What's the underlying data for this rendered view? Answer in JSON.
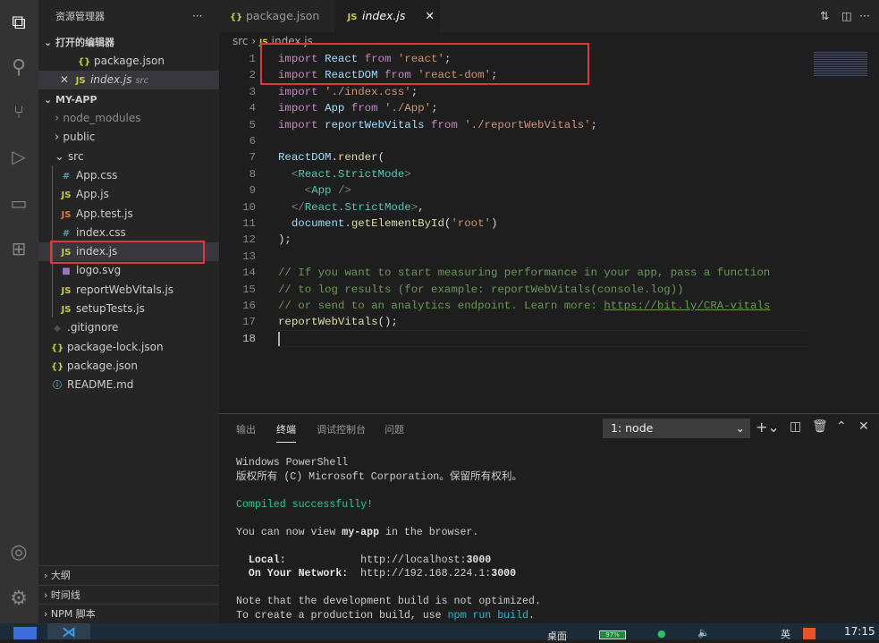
{
  "sidebar": {
    "title": "资源管理器",
    "more": "···",
    "open_editors": "打开的编辑器",
    "open_items": [
      {
        "icon": "{}",
        "name": "package.json",
        "dir": ""
      },
      {
        "icon": "JS",
        "name": "index.js",
        "dir": "src"
      }
    ],
    "project": "MY-APP",
    "tree": [
      {
        "label": "node_modules",
        "type": "folder",
        "depth": 0,
        "expanded": false,
        "dim": true
      },
      {
        "label": "public",
        "type": "folder",
        "depth": 0,
        "expanded": false
      },
      {
        "label": "src",
        "type": "folder",
        "depth": 0,
        "expanded": true
      },
      {
        "label": "App.css",
        "icon": "#",
        "cls": "css",
        "depth": 1
      },
      {
        "label": "App.js",
        "icon": "JS",
        "cls": "js",
        "depth": 1
      },
      {
        "label": "App.test.js",
        "icon": "JS",
        "cls": "jsr",
        "depth": 1
      },
      {
        "label": "index.css",
        "icon": "#",
        "cls": "css",
        "depth": 1
      },
      {
        "label": "index.js",
        "icon": "JS",
        "cls": "js",
        "depth": 1,
        "selected": true
      },
      {
        "label": "logo.svg",
        "icon": "■",
        "cls": "svg",
        "depth": 1
      },
      {
        "label": "reportWebVitals.js",
        "icon": "JS",
        "cls": "js",
        "depth": 1
      },
      {
        "label": "setupTests.js",
        "icon": "JS",
        "cls": "js",
        "depth": 1
      },
      {
        "label": ".gitignore",
        "icon": "◆",
        "cls": "git",
        "depth": 0
      },
      {
        "label": "package-lock.json",
        "icon": "{}",
        "cls": "json",
        "depth": 0
      },
      {
        "label": "package.json",
        "icon": "{}",
        "cls": "json",
        "depth": 0
      },
      {
        "label": "README.md",
        "icon": "ⓘ",
        "cls": "css",
        "depth": 0
      }
    ],
    "bottom": [
      "大纲",
      "时间线",
      "NPM 脚本"
    ]
  },
  "tabs": [
    {
      "icon": "{}",
      "label": "package.json",
      "active": false
    },
    {
      "icon": "JS",
      "label": "index.js",
      "active": true
    }
  ],
  "breadcrumb": {
    "folder": "src",
    "file": "index.js"
  },
  "code": [
    [
      [
        "k",
        "import"
      ],
      [
        "d",
        " "
      ],
      [
        "v",
        "React"
      ],
      [
        "d",
        " "
      ],
      [
        "k",
        "from"
      ],
      [
        "d",
        " "
      ],
      [
        "s",
        "'react'"
      ],
      [
        "d",
        ";"
      ]
    ],
    [
      [
        "k",
        "import"
      ],
      [
        "d",
        " "
      ],
      [
        "v",
        "ReactDOM"
      ],
      [
        "d",
        " "
      ],
      [
        "k",
        "from"
      ],
      [
        "d",
        " "
      ],
      [
        "s",
        "'react-dom'"
      ],
      [
        "d",
        ";"
      ]
    ],
    [
      [
        "k",
        "import"
      ],
      [
        "d",
        " "
      ],
      [
        "s",
        "'./index.css'"
      ],
      [
        "d",
        ";"
      ]
    ],
    [
      [
        "k",
        "import"
      ],
      [
        "d",
        " "
      ],
      [
        "v",
        "App"
      ],
      [
        "d",
        " "
      ],
      [
        "k",
        "from"
      ],
      [
        "d",
        " "
      ],
      [
        "s",
        "'./App'"
      ],
      [
        "d",
        ";"
      ]
    ],
    [
      [
        "k",
        "import"
      ],
      [
        "d",
        " "
      ],
      [
        "v",
        "reportWebVitals"
      ],
      [
        "d",
        " "
      ],
      [
        "k",
        "from"
      ],
      [
        "d",
        " "
      ],
      [
        "s",
        "'./reportWebVitals'"
      ],
      [
        "d",
        ";"
      ]
    ],
    [],
    [
      [
        "v",
        "ReactDOM"
      ],
      [
        "d",
        "."
      ],
      [
        "f",
        "render"
      ],
      [
        "d",
        "("
      ]
    ],
    [
      [
        "d",
        "  "
      ],
      [
        "p",
        "<"
      ],
      [
        "t",
        "React.StrictMode"
      ],
      [
        "p",
        ">"
      ]
    ],
    [
      [
        "d",
        "    "
      ],
      [
        "p",
        "<"
      ],
      [
        "t",
        "App"
      ],
      [
        "d",
        " "
      ],
      [
        "p",
        "/>"
      ]
    ],
    [
      [
        "d",
        "  "
      ],
      [
        "p",
        "</"
      ],
      [
        "t",
        "React.StrictMode"
      ],
      [
        "p",
        ">"
      ],
      [
        "d",
        ","
      ]
    ],
    [
      [
        "d",
        "  "
      ],
      [
        "v",
        "document"
      ],
      [
        "d",
        "."
      ],
      [
        "f",
        "getElementById"
      ],
      [
        "d",
        "("
      ],
      [
        "s",
        "'root'"
      ],
      [
        "d",
        ")"
      ]
    ],
    [
      [
        "d",
        ");"
      ]
    ],
    [],
    [
      [
        "c",
        "// If you want to start measuring performance in your app, pass a function"
      ]
    ],
    [
      [
        "c",
        "// to log results (for example: reportWebVitals(console.log))"
      ]
    ],
    [
      [
        "c",
        "// or send to an analytics endpoint. Learn more: "
      ],
      [
        "u",
        "https://bit.ly/CRA-vitals"
      ]
    ],
    [
      [
        "f",
        "reportWebVitals"
      ],
      [
        "d",
        "();"
      ]
    ],
    []
  ],
  "panel": {
    "tabs": [
      "输出",
      "终端",
      "调试控制台",
      "问题"
    ],
    "active_tab": "终端",
    "terminal_select": "1: node"
  },
  "terminal": [
    {
      "y": 0,
      "parts": [
        [
          "",
          "Windows PowerShell"
        ]
      ]
    },
    {
      "y": 1,
      "parts": [
        [
          "",
          "版权所有 (C) Microsoft Corporation。保留所有权利。"
        ]
      ]
    },
    {
      "y": 3,
      "parts": [
        [
          "g",
          "Compiled successfully!"
        ]
      ]
    },
    {
      "y": 5,
      "parts": [
        [
          "",
          "You can now view "
        ],
        [
          "b",
          "my-app"
        ],
        [
          "",
          " in the browser."
        ]
      ]
    },
    {
      "y": 7,
      "parts": [
        [
          "b",
          "  Local:"
        ],
        [
          "",
          "            http://localhost:"
        ],
        [
          "b",
          "3000"
        ]
      ]
    },
    {
      "y": 8,
      "parts": [
        [
          "b",
          "  On Your Network:"
        ],
        [
          "",
          "  http://192.168.224.1:"
        ],
        [
          "b",
          "3000"
        ]
      ]
    },
    {
      "y": 10,
      "parts": [
        [
          "",
          "Note that the development build is not optimized."
        ]
      ]
    },
    {
      "y": 11,
      "parts": [
        [
          "",
          "To create a production build, use "
        ],
        [
          "cy",
          "npm run build"
        ],
        [
          "",
          "."
        ]
      ]
    }
  ],
  "taskbar": {
    "desktop": "桌面",
    "battery": "97%",
    "ime": "英",
    "time": "17:15"
  },
  "colors": {
    "activity": "#333333",
    "sidebar": "#252526",
    "editor": "#1e1e1e",
    "highlight": "#e0383e"
  }
}
